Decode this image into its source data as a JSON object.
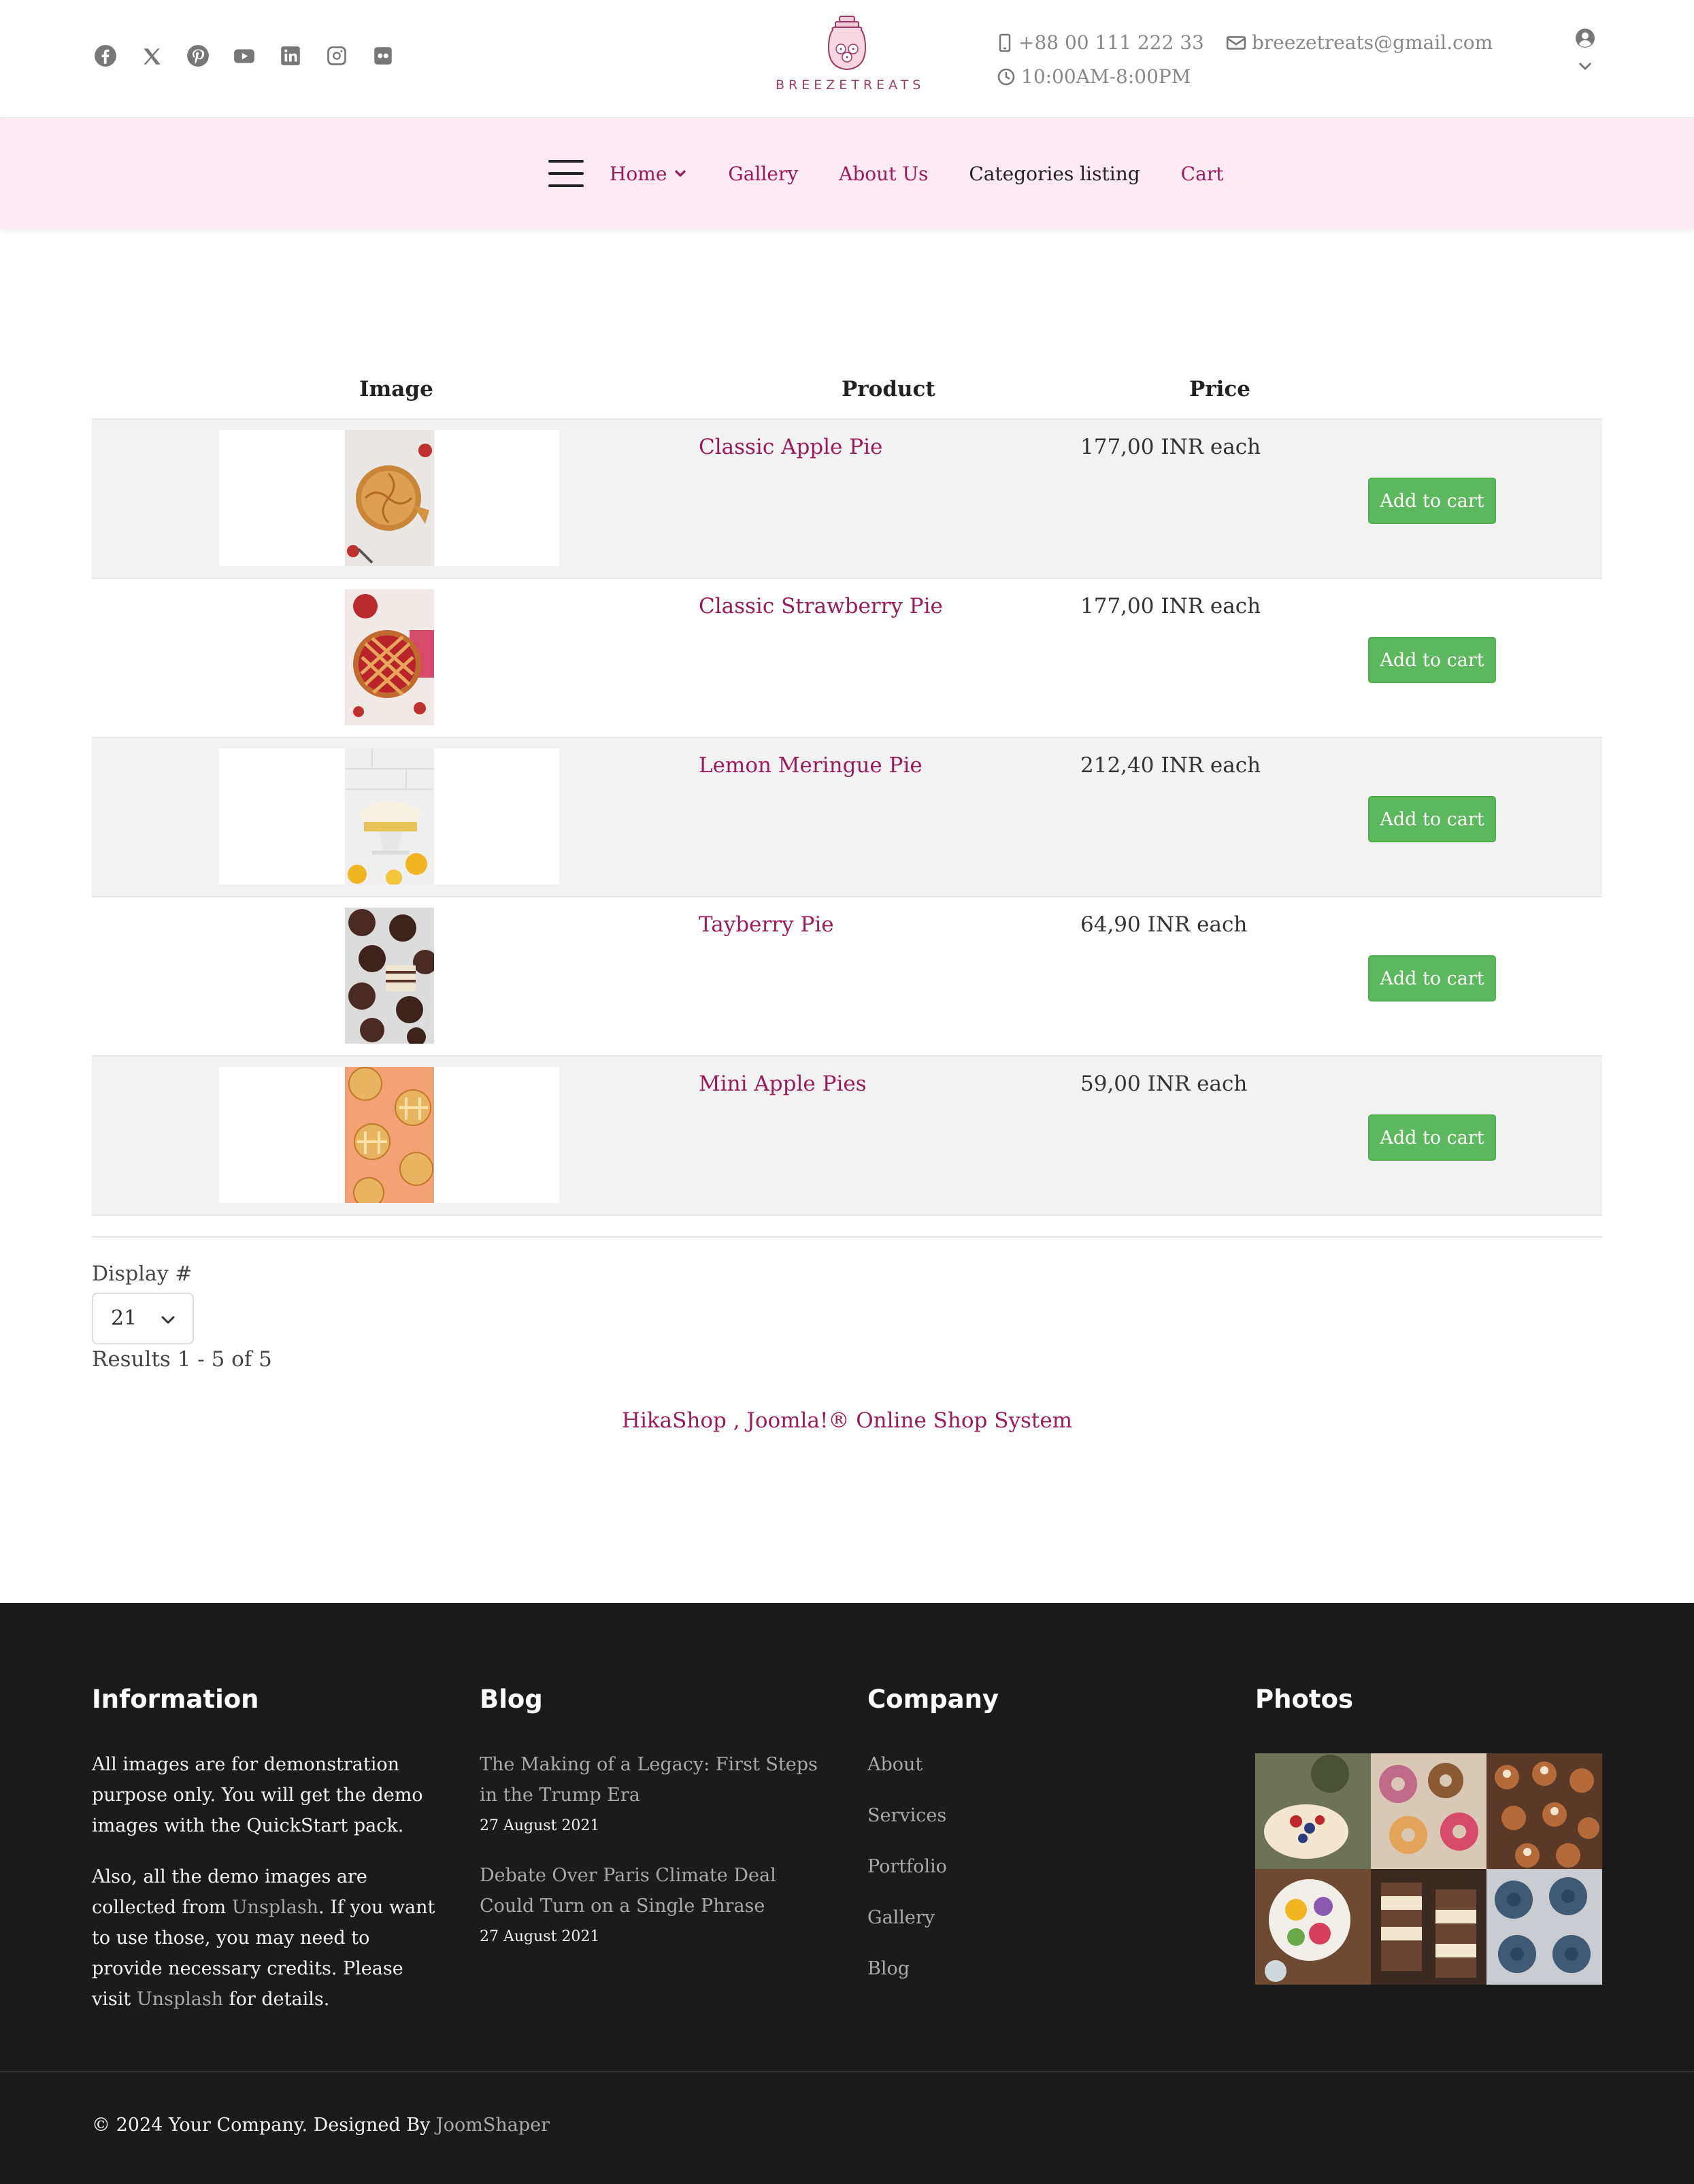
{
  "header": {
    "social": [
      "facebook-icon",
      "x-twitter-icon",
      "pinterest-icon",
      "youtube-icon",
      "linkedin-icon",
      "instagram-icon",
      "flickr-icon"
    ],
    "logo_text": "BREEZETREATS",
    "phone": "+88 00 111 222 33",
    "email": "breezetreats@gmail.com",
    "hours": "10:00AM-8:00PM"
  },
  "nav": {
    "items": [
      {
        "label": "Home",
        "has_dropdown": true
      },
      {
        "label": "Gallery"
      },
      {
        "label": "About Us"
      },
      {
        "label": "Categories listing",
        "active": true
      },
      {
        "label": "Cart"
      }
    ]
  },
  "table": {
    "headers": {
      "image": "Image",
      "product": "Product",
      "price": "Price"
    },
    "rows": [
      {
        "name": "Classic Apple Pie",
        "price": "177,00 INR each",
        "button": "Add to cart"
      },
      {
        "name": "Classic Strawberry Pie",
        "price": "177,00 INR each",
        "button": "Add to cart"
      },
      {
        "name": "Lemon Meringue Pie",
        "price": "212,40 INR each",
        "button": "Add to cart"
      },
      {
        "name": "Tayberry Pie",
        "price": "64,90 INR each",
        "button": "Add to cart"
      },
      {
        "name": "Mini Apple Pies",
        "price": "59,00 INR each",
        "button": "Add to cart"
      }
    ]
  },
  "pagination": {
    "display_label": "Display #",
    "display_value": "21",
    "results": "Results 1 - 5 of 5"
  },
  "powered_by": "HikaShop , Joomla!® Online Shop System",
  "footer": {
    "information": {
      "title": "Information",
      "p1": "All images are for demonstration purpose only. You will get the demo images with the QuickStart pack.",
      "p2_a": "Also, all the demo images are collected from ",
      "p2_link1": "Unsplash",
      "p2_b": ". If you want to use those, you may need to provide necessary credits. Please visit ",
      "p2_link2": "Unsplash",
      "p2_c": " for details."
    },
    "blog": {
      "title": "Blog",
      "posts": [
        {
          "title": "The Making of a Legacy: First Steps in the Trump Era",
          "date": "27 August 2021"
        },
        {
          "title": "Debate Over Paris Climate Deal Could Turn on a Single Phrase",
          "date": "27 August 2021"
        }
      ]
    },
    "company": {
      "title": "Company",
      "links": [
        "About",
        "Services",
        "Portfolio",
        "Gallery",
        "Blog"
      ]
    },
    "photos": {
      "title": "Photos"
    },
    "copyright_text": "© 2024 Your Company. Designed By ",
    "copyright_link": "JoomShaper"
  },
  "colors": {
    "accent": "#9b1b5a",
    "nav_bg": "#ffeaf4",
    "button_green": "#5cb85c",
    "footer_bg": "#1b1b1b"
  }
}
